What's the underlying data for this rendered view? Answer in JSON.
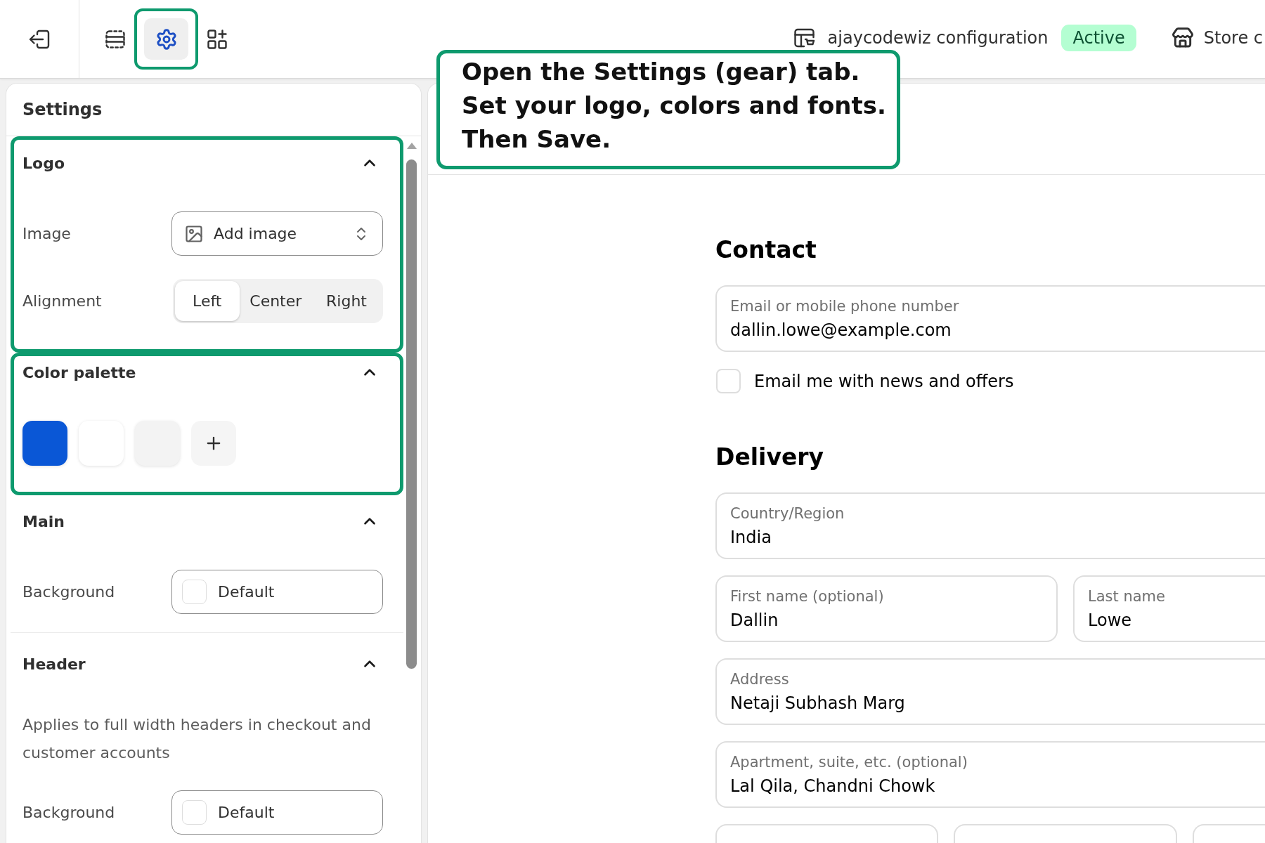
{
  "top_bar": {
    "tools": [
      {
        "kind": "layout",
        "selected": false,
        "highlighted": false
      },
      {
        "kind": "settings",
        "selected": true,
        "highlighted": true
      },
      {
        "kind": "apps",
        "selected": false,
        "highlighted": false
      }
    ],
    "configuration": {
      "name": "ajaycodewiz configuration",
      "status": "Active"
    },
    "store": {
      "label": "Store c"
    }
  },
  "callout": {
    "lines": [
      "Open the Settings (gear) tab.",
      "Set your logo, colors and fonts.",
      "Then Save."
    ]
  },
  "settings_panel": {
    "title": "Settings",
    "sections": [
      {
        "title": "Logo",
        "expanded": true,
        "highlighted": true,
        "rows": [
          {
            "kind": "select",
            "label": "Image",
            "value": "Add image"
          },
          {
            "kind": "segmented",
            "label": "Alignment",
            "options": [
              {
                "label": "Left",
                "selected": true
              },
              {
                "label": "Center",
                "selected": false
              },
              {
                "label": "Right",
                "selected": false
              }
            ]
          }
        ]
      },
      {
        "title": "Color palette",
        "expanded": true,
        "highlighted": true,
        "rows": [
          {
            "kind": "swatches",
            "swatches": [
              {
                "color": "#0a57d6"
              },
              {
                "color": "#ffffff"
              },
              {
                "color": "#f3f3f3"
              }
            ]
          }
        ]
      },
      {
        "title": "Main",
        "expanded": true,
        "highlighted": false,
        "rows": [
          {
            "kind": "color",
            "label": "Background",
            "value": "Default"
          }
        ]
      },
      {
        "title": "Header",
        "expanded": true,
        "highlighted": false,
        "rows": [
          {
            "kind": "note",
            "text": "Applies to full width headers in checkout and customer accounts"
          },
          {
            "kind": "color",
            "label": "Background",
            "value": "Default"
          }
        ]
      }
    ]
  },
  "checkout": {
    "sections": [
      {
        "title": "Contact",
        "items": [
          {
            "kind": "field",
            "label": "Email or mobile phone number",
            "value": "dallin.lowe@example.com"
          },
          {
            "kind": "checkbox",
            "label": "Email me with news and offers",
            "checked": false
          }
        ]
      },
      {
        "title": "Delivery",
        "items": [
          {
            "kind": "field",
            "label": "Country/Region",
            "value": "India"
          },
          {
            "kind": "row",
            "fields": [
              {
                "kind": "field",
                "label": "First name (optional)",
                "value": "Dallin"
              },
              {
                "kind": "field",
                "label": "Last name",
                "value": "Lowe"
              }
            ]
          },
          {
            "kind": "field",
            "label": "Address",
            "value": "Netaji Subhash Marg"
          },
          {
            "kind": "field",
            "label": "Apartment, suite, etc. (optional)",
            "value": "Lal Qila, Chandni Chowk"
          },
          {
            "kind": "row",
            "fields": [
              {
                "kind": "field"
              },
              {
                "kind": "field"
              },
              {
                "kind": "field"
              }
            ]
          }
        ]
      }
    ]
  }
}
